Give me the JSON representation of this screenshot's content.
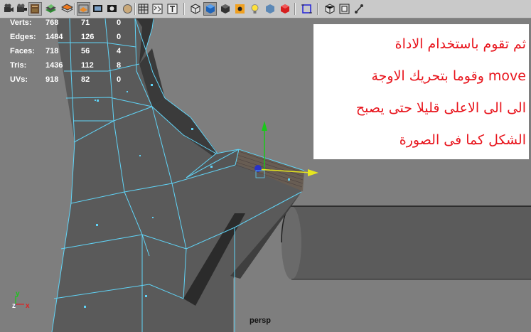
{
  "toolbar": {
    "icons": [
      "render-camera-icon",
      "render-settings-icon",
      "hypershade-book-icon",
      "paint-layers-icon",
      "grid-snap-icon",
      "film-gate-icon",
      "resolution-gate-icon",
      "shaded-sphere-icon",
      "wireframe-grid-icon",
      "uv-texture-icon",
      "text-icon",
      "isolate-cube-icon",
      "smooth-shade-cube-icon",
      "flat-shade-cube-icon",
      "texture-icon",
      "light-bulb-icon",
      "shadow-cube-icon",
      "xray-cube-icon",
      "high-quality-cube-icon",
      "frame-selection-icon",
      "camera-cube-icon",
      "safe-frame-icon",
      "joint-xray-icon"
    ]
  },
  "hud": {
    "rows": [
      {
        "label": "Verts:",
        "v1": "768",
        "v2": "71",
        "v3": "0"
      },
      {
        "label": "Edges:",
        "v1": "1484",
        "v2": "126",
        "v3": "0"
      },
      {
        "label": "Faces:",
        "v1": "718",
        "v2": "56",
        "v3": "4"
      },
      {
        "label": "Tris:",
        "v1": "1436",
        "v2": "112",
        "v3": "8"
      },
      {
        "label": "UVs:",
        "v1": "918",
        "v2": "82",
        "v3": "0"
      }
    ]
  },
  "note": {
    "lines": [
      "ثم تقوم باستخدام الاداة",
      "move وقوما بتحريك الاوجة",
      "الى الى الاعلى قليلا حتى يصبح",
      "الشكل كما فى الصورة"
    ]
  },
  "viewport": {
    "camera": "persp",
    "axis": {
      "y": "y",
      "z": "z",
      "x": "x"
    }
  },
  "colors": {
    "background": "#7e7e7e",
    "mesh": "#595959",
    "wire": "#5fd2f5",
    "note_text": "#e8141c",
    "manip_y": "#19c819",
    "manip_x": "#e6e61e",
    "manip_center": "#2832c8"
  }
}
